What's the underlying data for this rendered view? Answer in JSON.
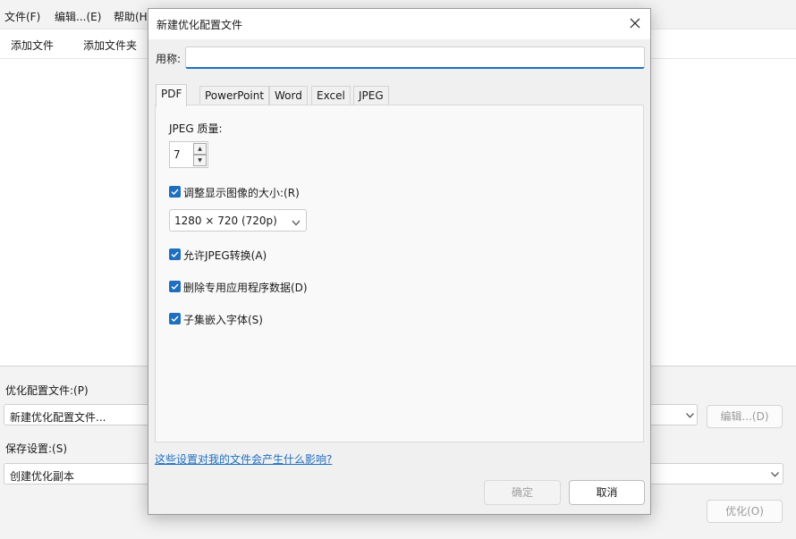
{
  "main_window": {
    "menu": [
      "文件(F)",
      "编辑...(E)",
      "帮助(H)"
    ],
    "toolbar": [
      "添加文件",
      "添加文件夹"
    ],
    "bottom": {
      "profile_label": "优化配置文件:(P)",
      "profile_value": "新建优化配置文件...",
      "edit_button": "编辑...(D)",
      "save_label": "保存设置:(S)",
      "save_value": "创建优化副本",
      "optimize_button": "优化(O)"
    }
  },
  "dialog": {
    "title": "新建优化配置文件",
    "name_label": "用称:",
    "name_value": "",
    "tabs": [
      "PDF",
      "PowerPoint",
      "Word",
      "Excel",
      "JPEG"
    ],
    "active_tab": "PDF",
    "jpeg_quality_label": "JPEG 质量:",
    "jpeg_quality_value": "7",
    "resize": {
      "label": "调整显示图像的大小:(R)",
      "checked": true
    },
    "resolution_selected": "1280 × 720 (720p)",
    "options": [
      {
        "label": "允许JPEG转换(A)",
        "checked": true
      },
      {
        "label": "删除专用应用程序数据(D)",
        "checked": true
      },
      {
        "label": "子集嵌入字体(S)",
        "checked": true
      }
    ],
    "help_link": "这些设置对我的文件会产生什么影响?",
    "ok_label": "确定",
    "cancel_label": "取消"
  },
  "colors": {
    "accent": "#1f6fbf",
    "dialog_bg": "#f0f0f0",
    "panel_bg": "#f9f9f9"
  },
  "icons": [
    "close-icon",
    "checkmark-icon",
    "chevron-down-icon",
    "spin-up-icon",
    "spin-down-icon"
  ]
}
